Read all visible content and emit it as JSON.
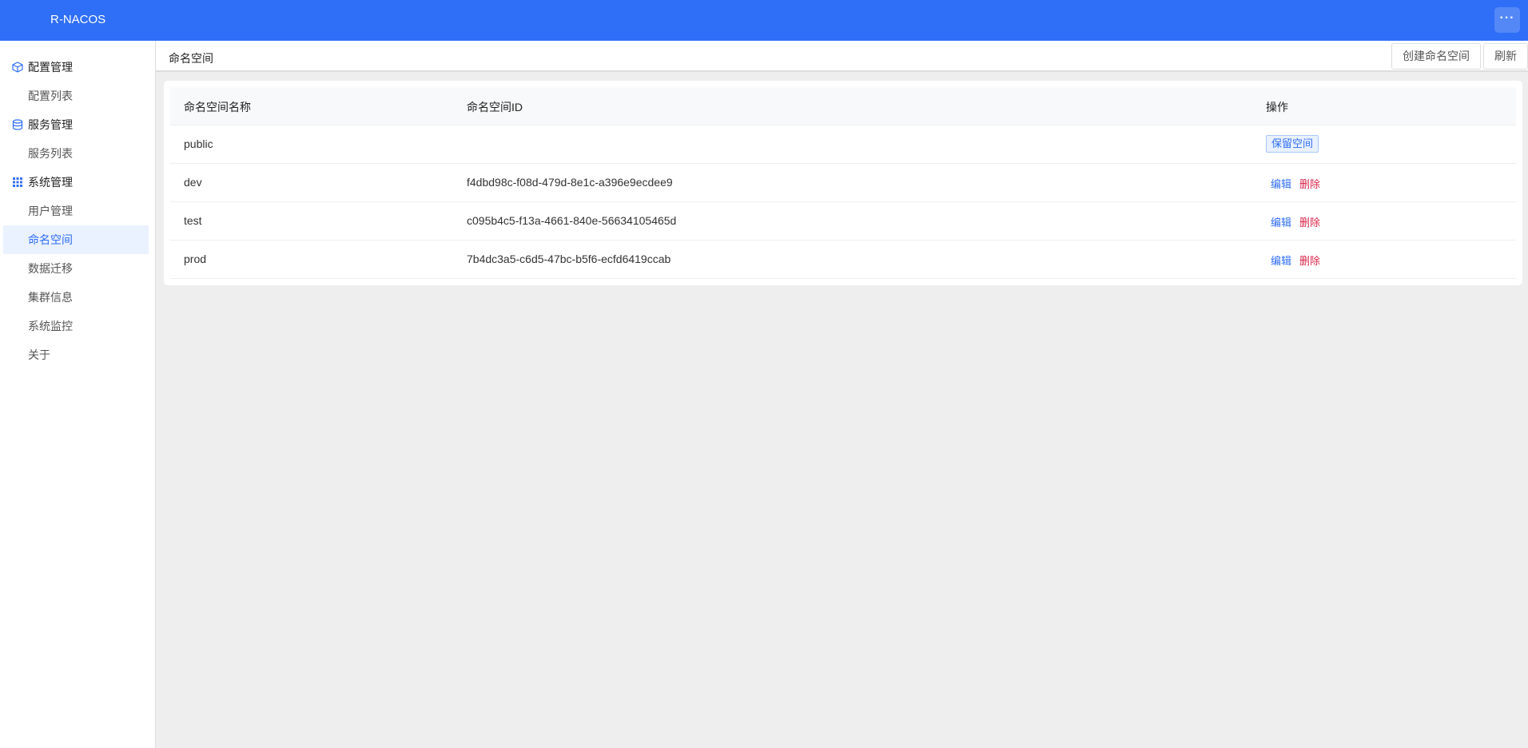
{
  "app": {
    "title": "R-NACOS",
    "more_icon": "more-icon"
  },
  "sidebar": {
    "groups": [
      {
        "label": "配置管理",
        "icon": "cube-icon",
        "items": [
          "配置列表"
        ]
      },
      {
        "label": "服务管理",
        "icon": "database-icon",
        "items": [
          "服务列表"
        ]
      },
      {
        "label": "系统管理",
        "icon": "grid-icon",
        "items": [
          "用户管理",
          "命名空间",
          "数据迁移",
          "集群信息",
          "系统监控",
          "关于"
        ]
      }
    ],
    "active": "命名空间"
  },
  "page": {
    "title": "命名空间",
    "create_label": "创建命名空间",
    "refresh_label": "刷新"
  },
  "table": {
    "headers": [
      "命名空间名称",
      "命名空间ID",
      "操作"
    ],
    "rows": [
      {
        "name": "public",
        "id": "",
        "tag": "保留空间"
      },
      {
        "name": "dev",
        "id": "f4dbd98c-f08d-479d-8e1c-a396e9ecdee9",
        "edit": "编辑",
        "delete": "删除"
      },
      {
        "name": "test",
        "id": "c095b4c5-f13a-4661-840e-56634105465d",
        "edit": "编辑",
        "delete": "删除"
      },
      {
        "name": "prod",
        "id": "7b4dc3a5-c6d5-47bc-b5f6-ecfd6419ccab",
        "edit": "编辑",
        "delete": "删除"
      }
    ]
  },
  "colors": {
    "brand": "#2f6ef6",
    "danger": "#d9264a"
  }
}
